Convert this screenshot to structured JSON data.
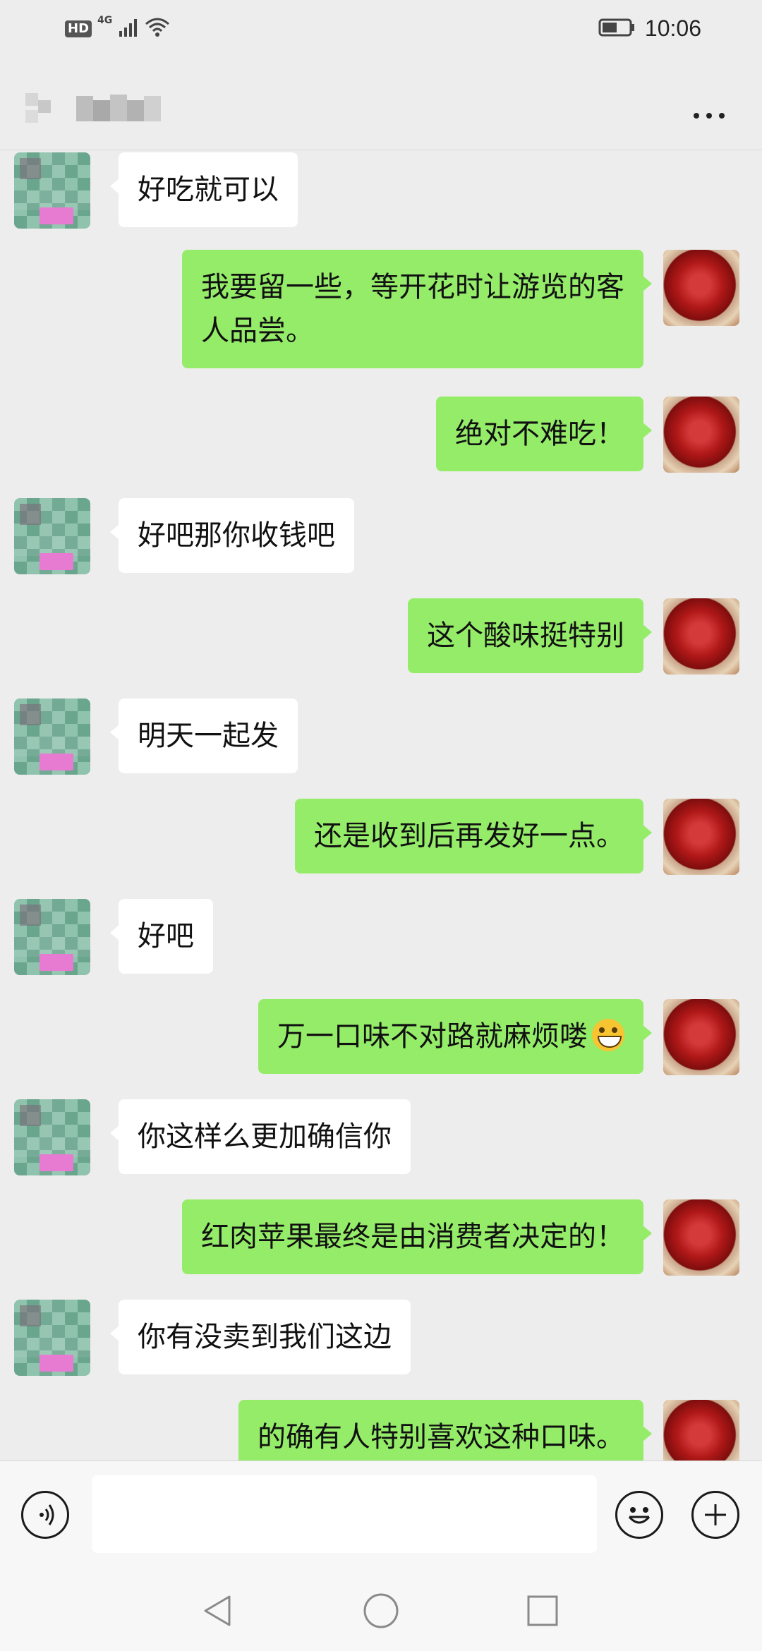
{
  "status_bar": {
    "hd": "HD",
    "network": "4G",
    "time": "10:06",
    "icons": [
      "hd-icon",
      "signal-icon",
      "wifi-icon",
      "battery-icon"
    ]
  },
  "header": {
    "contact_name_obscured": true,
    "more_icon": "more-dots-icon"
  },
  "messages": [
    {
      "side": "received",
      "text": "好吃就可以"
    },
    {
      "side": "sent",
      "text": "我要留一些，等开花时让游览的客\n人品尝。"
    },
    {
      "side": "sent",
      "text": "绝对不难吃！"
    },
    {
      "side": "received",
      "text": "好吧那你收钱吧"
    },
    {
      "side": "sent",
      "text": "这个酸味挺特别"
    },
    {
      "side": "received",
      "text": "明天一起发"
    },
    {
      "side": "sent",
      "text": "还是收到后再发好一点。"
    },
    {
      "side": "received",
      "text": "好吧"
    },
    {
      "side": "sent",
      "text": "万一口味不对路就麻烦喽",
      "emoji": "grinning-face-icon"
    },
    {
      "side": "received",
      "text": "你这样么更加确信你"
    },
    {
      "side": "sent",
      "text": "红肉苹果最终是由消费者决定的！"
    },
    {
      "side": "received",
      "text": "你有没卖到我们这边"
    },
    {
      "side": "sent",
      "text": "的确有人特别喜欢这种口味。"
    }
  ],
  "input_bar": {
    "text_value": "",
    "voice_icon": "voice-icon",
    "emoji_icon": "emoji-smile-icon",
    "plus_icon": "plus-icon"
  },
  "nav_bar": {
    "icons": [
      "back-triangle-icon",
      "home-circle-icon",
      "recents-square-icon"
    ]
  }
}
